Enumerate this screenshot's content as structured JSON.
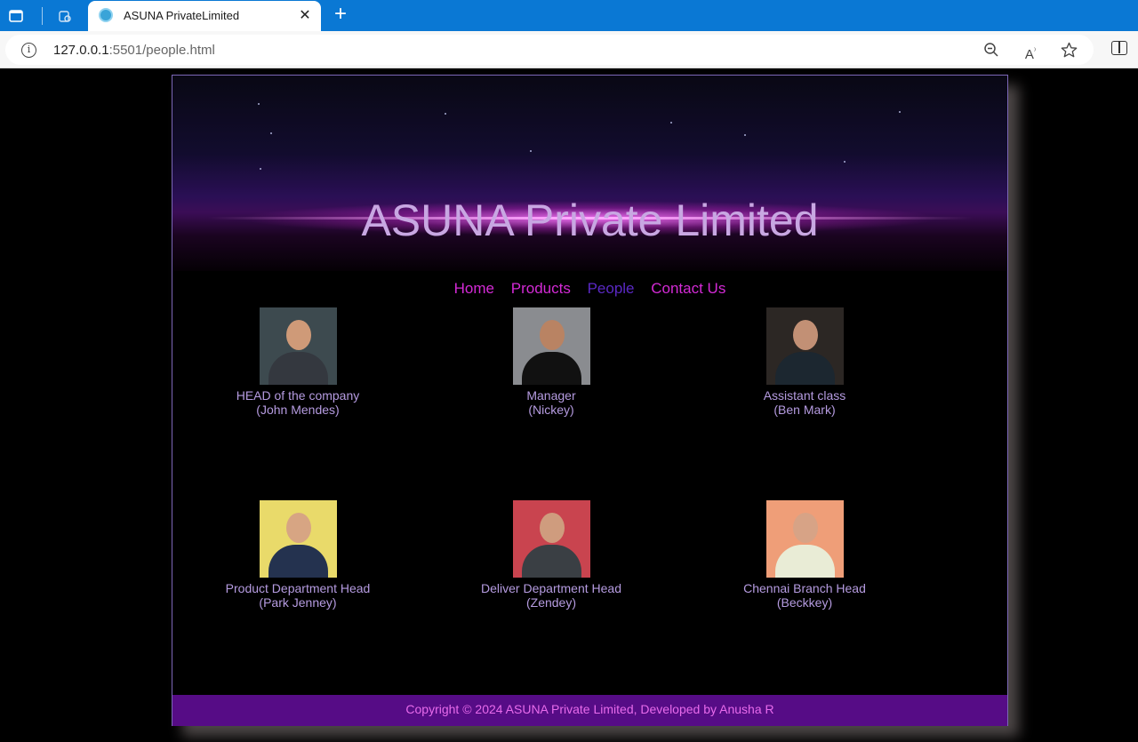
{
  "browser": {
    "tab_title": "ASUNA PrivateLimited",
    "url_host": "127.0.0.1",
    "url_path": ":5501/people.html"
  },
  "site": {
    "title": "ASUNA Private Limited",
    "nav": [
      "Home",
      "Products",
      "People",
      "Contact Us"
    ],
    "active_nav": "People",
    "people": [
      {
        "role": "HEAD of the company",
        "name": "(John Mendes)"
      },
      {
        "role": "Manager",
        "name": "(Nickey)"
      },
      {
        "role": "Assistant class",
        "name": "(Ben Mark)"
      },
      {
        "role": "Product Department Head",
        "name": "(Park Jenney)"
      },
      {
        "role": "Deliver Department Head",
        "name": "(Zendey)"
      },
      {
        "role": "Chennai Branch Head",
        "name": "(Beckkey)"
      }
    ],
    "footer": "Copyright © 2024 ASUNA Private Limited, Developed by Anusha R"
  },
  "colors": {
    "nav_link": "#d42ad6",
    "nav_active": "#5a28c4",
    "caption": "#b59be0",
    "footer_bg": "#560c86",
    "footer_text": "#e86bec"
  }
}
